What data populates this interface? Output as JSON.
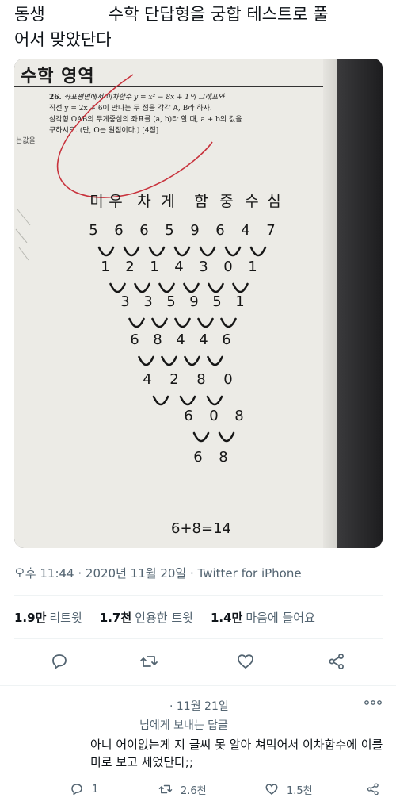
{
  "tweet": {
    "text_line1": "동생            수학 단답형을 궁합 테스트로 풀",
    "text_line2": "어서 맞았단다"
  },
  "photo": {
    "exam_header": "수학 영역",
    "problem_number": "26.",
    "problem_lines": [
      "좌표평면에서 이차함수 y = x² − 8x + 1의 그래프와",
      "직선 y = 2x + 6이 만나는 두 점을 각각 A, B라 하자.",
      "삼각형 OAB의 무게중심의 좌표를 (a, b)라 할 때, a + b의 값을",
      "구하시오. (단, O는 원점이다.) [4점]"
    ],
    "margin_text": "는값을",
    "names": [
      "미",
      "우",
      "차",
      "게",
      "함",
      "중",
      "수",
      "심"
    ],
    "row1": [
      "5",
      "6",
      "6",
      "5",
      "9",
      "6",
      "4",
      "7"
    ],
    "row2": [
      "1",
      "2",
      "1",
      "4",
      "3",
      "0",
      "1"
    ],
    "row3": [
      "3",
      "3",
      "5",
      "9",
      "5",
      "1"
    ],
    "row4": [
      "6",
      "8",
      "4",
      "4",
      "6"
    ],
    "row5": [
      "4",
      "2",
      "8",
      "0"
    ],
    "row6": [
      "6",
      "0",
      "8"
    ],
    "row7": [
      "6",
      "8"
    ],
    "answer": "6+8=14"
  },
  "meta": {
    "time": "오후 11:44",
    "date": "2020년 11월 20일",
    "source": "Twitter for iPhone"
  },
  "stats": {
    "retweets_count": "1.9만",
    "retweets_label": "리트윗",
    "quotes_count": "1.7천",
    "quotes_label": "인용한 트윗",
    "likes_count": "1.4만",
    "likes_label": "마음에 들어요"
  },
  "reply": {
    "date": "· 11월 21일",
    "replying_to": "님에게 보내는 답글",
    "text": "아니 어이없는게 지 글씨 못 알아 쳐먹어서 이차함수에 이를 미로 보고 세었단다;;",
    "reply_count": "1",
    "retweet_count": "2.6천",
    "like_count": "1.5천"
  },
  "colors": {
    "text": "#0f1419",
    "secondary": "#536471",
    "divider": "#eff3f4",
    "red_pen": "#c8323c"
  },
  "icons": [
    "reply-icon",
    "retweet-icon",
    "like-icon",
    "share-icon",
    "more-icon"
  ]
}
